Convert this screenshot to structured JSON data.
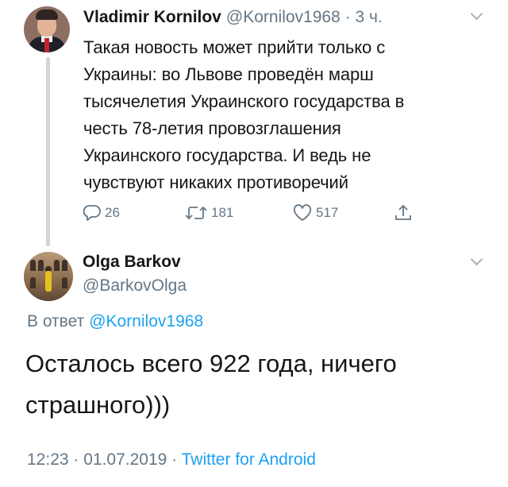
{
  "parent_tweet": {
    "author_name": "Vladimir Kornilov",
    "handle": "@Kornilov1968",
    "separator": " · ",
    "time": "3 ч.",
    "text_lines": [
      "Такая новость может прийти только с",
      "Украины: во Львове проведён марш",
      "тысячелетия Украинского государства в",
      "честь 78-летия провозглашения",
      "Украинского государства. И ведь не",
      "чувствуют никаких противоречий"
    ],
    "actions": {
      "reply_count": "26",
      "retweet_count": "181",
      "like_count": "517"
    }
  },
  "reply_tweet": {
    "author_name": "Olga Barkov",
    "handle": "@BarkovOlga",
    "reply_to_label": "В ответ",
    "reply_to_mention": "@Kornilov1968",
    "text_lines": [
      "Осталось всего 922 года, ничего",
      "страшного)))"
    ],
    "time": "12:23",
    "separator": " · ",
    "date": "01.07.2019",
    "separator2": " · ",
    "source": "Twitter for Android"
  },
  "icons": {
    "reply": "reply-icon",
    "retweet": "retweet-icon",
    "like": "heart-icon",
    "share": "share-icon",
    "more": "chevron-down-icon"
  },
  "colors": {
    "text": "#14171a",
    "secondary": "#657786",
    "link": "#1da1f2",
    "thread_line": "#ccd6dd"
  }
}
